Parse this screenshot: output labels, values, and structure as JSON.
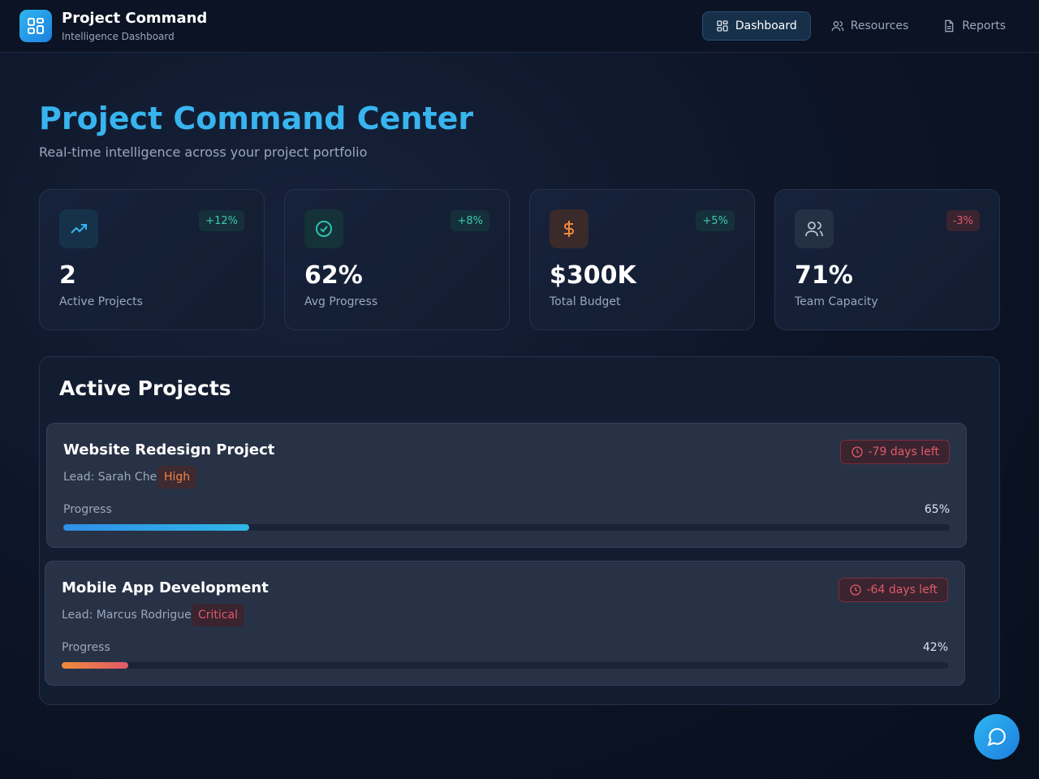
{
  "header": {
    "app_title": "Project Command",
    "app_subtitle": "Intelligence Dashboard",
    "nav": [
      {
        "label": "Dashboard",
        "icon": "grid-icon",
        "active": true
      },
      {
        "label": "Resources",
        "icon": "users-icon",
        "active": false
      },
      {
        "label": "Reports",
        "icon": "document-icon",
        "active": false
      }
    ]
  },
  "page": {
    "title": "Project Command Center",
    "subtitle": "Real-time intelligence across your project portfolio"
  },
  "stats": [
    {
      "value": "2",
      "label": "Active Projects",
      "delta": "+12%",
      "icon": "trending-up-icon",
      "accent": "#38b4ee",
      "delta_color": "#3fc9b0"
    },
    {
      "value": "62%",
      "label": "Avg Progress",
      "delta": "+8%",
      "icon": "check-circle-icon",
      "accent": "#2dc2b0",
      "delta_color": "#3fc9b0"
    },
    {
      "value": "$300K",
      "label": "Total Budget",
      "delta": "+5%",
      "icon": "dollar-icon",
      "accent": "#f08a3a",
      "delta_color": "#3fc9b0"
    },
    {
      "value": "71%",
      "label": "Team Capacity",
      "delta": "-3%",
      "icon": "users-icon",
      "accent": "#9aa7bc",
      "delta_color": "#e05a68"
    }
  ],
  "projects_section": {
    "title": "Active Projects",
    "progress_label": "Progress",
    "projects": [
      {
        "name": "Website Redesign Project",
        "lead": "Lead: Sarah Chen",
        "priority": "High",
        "priority_color": "#f0854a",
        "days_left": "-79 days left",
        "progress": "65%",
        "progress_fill": 0.21,
        "fill_colors": [
          "#2f8fe8",
          "#2fb6e8"
        ]
      },
      {
        "name": "Mobile App Development",
        "lead": "Lead: Marcus Rodriguez",
        "priority": "Critical",
        "priority_color": "#e05a68",
        "days_left": "-64 days left",
        "progress": "42%",
        "progress_fill": 0.075,
        "fill_colors": [
          "#f08a3a",
          "#e05a68"
        ]
      }
    ]
  },
  "chat": {
    "icon": "chat-bubble-icon"
  }
}
